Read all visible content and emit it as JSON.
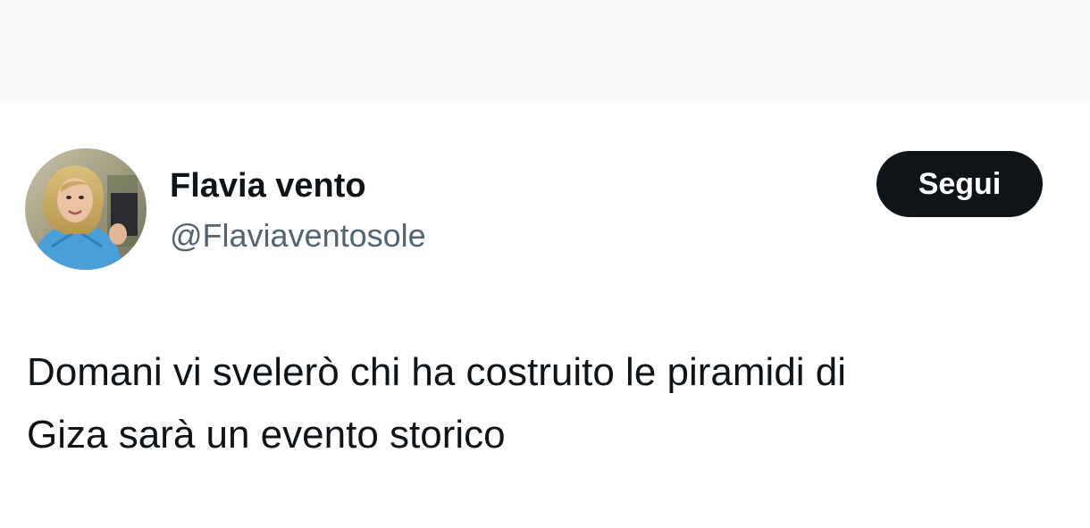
{
  "tweet": {
    "author": {
      "name": "Flavia vento",
      "handle": "@Flaviaventosole"
    },
    "follow_label": "Segui",
    "text_lines": [
      "Domani vi svelerò chi ha costruito le piramidi di",
      "Giza sarà un evento storico"
    ]
  },
  "colors": {
    "text_primary": "#0f1419",
    "text_secondary": "#536471",
    "button_bg": "#0f1419",
    "button_text": "#ffffff",
    "top_band": "#fafafa"
  }
}
